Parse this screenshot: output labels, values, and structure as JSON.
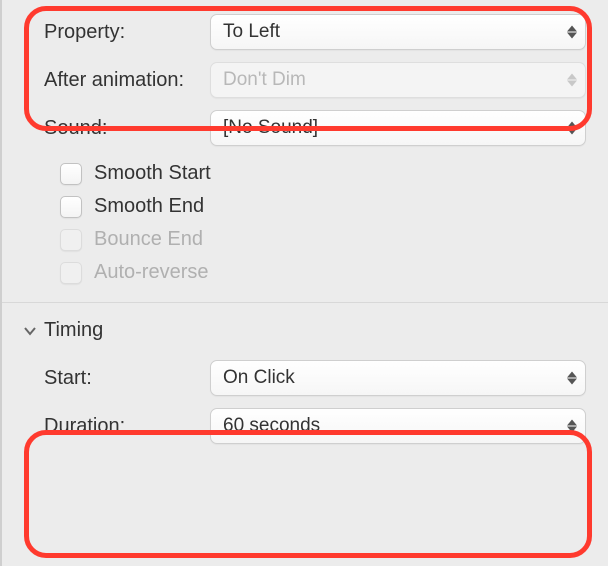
{
  "effectOptions": {
    "property": {
      "label": "Property:",
      "value": "To Left"
    },
    "afterAnimation": {
      "label": "After animation:",
      "value": "Don't Dim"
    },
    "sound": {
      "label": "Sound:",
      "value": "[No Sound]"
    },
    "checkboxes": {
      "smoothStart": "Smooth Start",
      "smoothEnd": "Smooth End",
      "bounceEnd": "Bounce End",
      "autoReverse": "Auto-reverse"
    }
  },
  "timing": {
    "sectionTitle": "Timing",
    "start": {
      "label": "Start:",
      "value": "On Click"
    },
    "duration": {
      "label": "Duration:",
      "value": "60 seconds"
    }
  }
}
